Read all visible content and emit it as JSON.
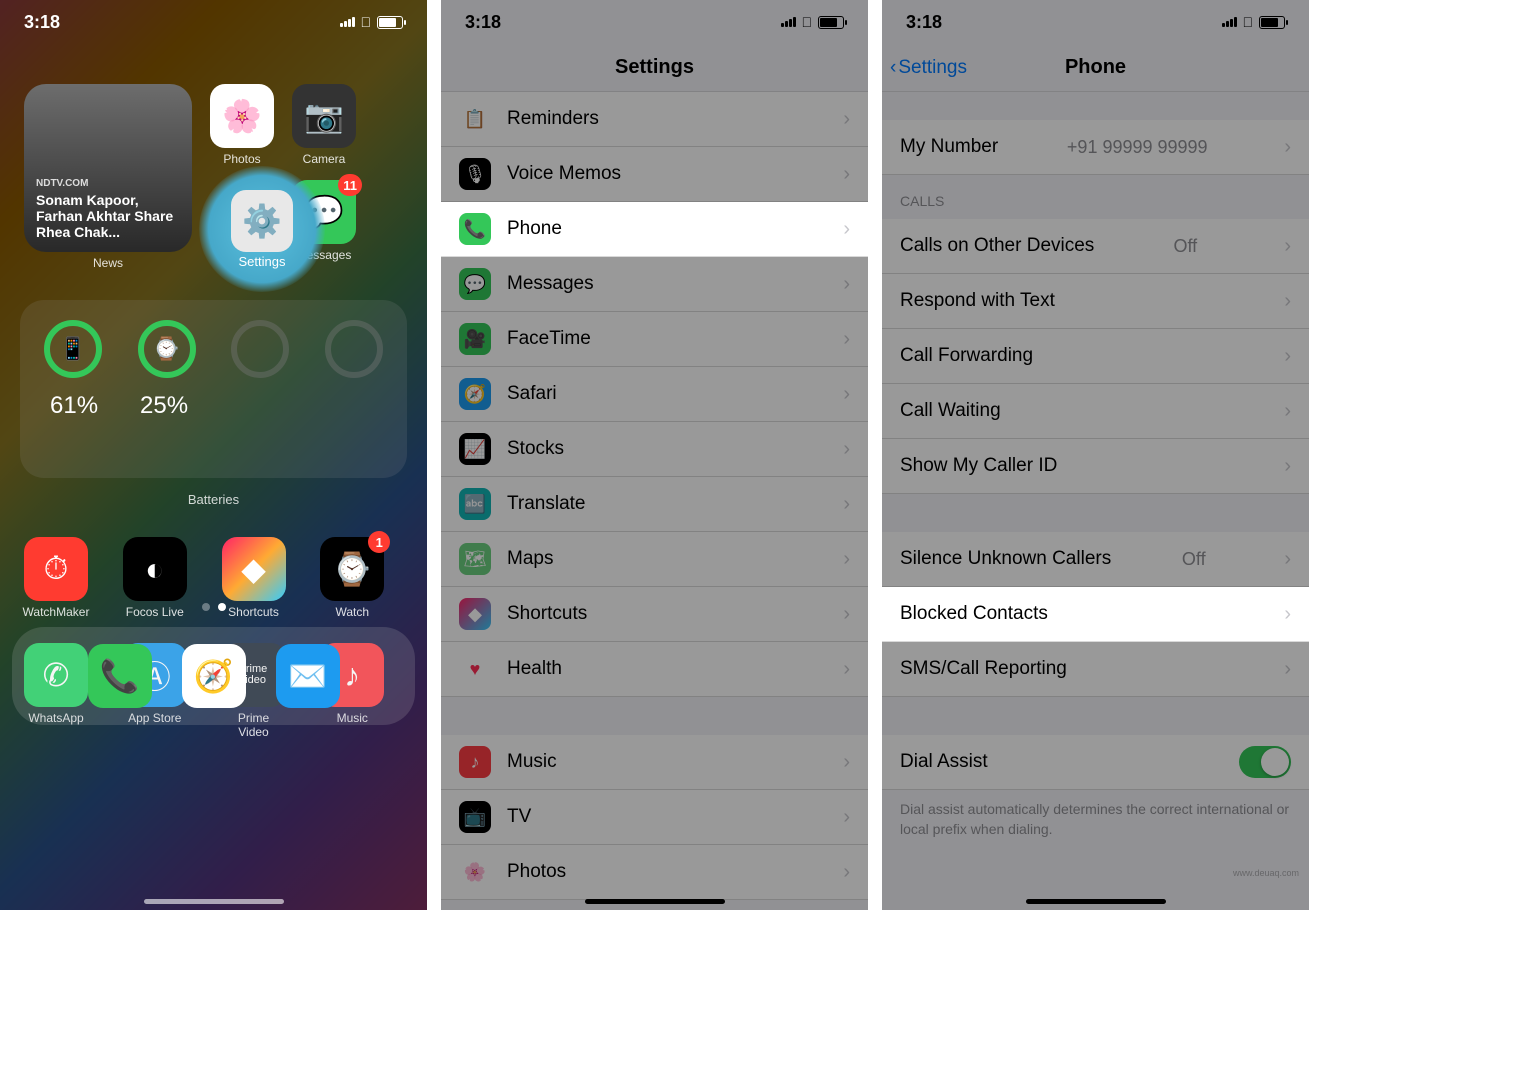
{
  "status": {
    "time": "3:18"
  },
  "p1": {
    "news": {
      "source": "NDTV.COM",
      "headline": "Sonam Kapoor, Farhan Akhtar Share Rhea Chak...",
      "label": "News"
    },
    "apps_row1": [
      {
        "name": "Photos",
        "label": "Photos",
        "bg": "#fff"
      },
      {
        "name": "Camera",
        "label": "Camera",
        "bg": "#333"
      }
    ],
    "highlight": {
      "name": "Settings",
      "label": "Settings"
    },
    "messages": {
      "label": "Messages",
      "badge": "11"
    },
    "batteries": {
      "label": "Batteries",
      "p1": "61%",
      "p2": "25%"
    },
    "grid": [
      {
        "label": "WatchMaker",
        "bg": "#ff3b30",
        "badge": ""
      },
      {
        "label": "Focos Live",
        "bg": "#000",
        "badge": ""
      },
      {
        "label": "Shortcuts",
        "bg": "#3a3a3c",
        "badge": ""
      },
      {
        "label": "Watch",
        "bg": "#000",
        "badge": "1"
      },
      {
        "label": "WhatsApp",
        "bg": "#25d366",
        "badge": ""
      },
      {
        "label": "App Store",
        "bg": "#1d9bf0",
        "badge": ""
      },
      {
        "label": "Prime Video",
        "bg": "#232f3e",
        "badge": ""
      },
      {
        "label": "Music",
        "bg": "#fc3c44",
        "badge": ""
      }
    ],
    "dock": [
      {
        "name": "Phone",
        "bg": "#34c759"
      },
      {
        "name": "Safari",
        "bg": "#fff"
      },
      {
        "name": "Mail",
        "bg": "#1d9bf0"
      }
    ]
  },
  "p2": {
    "title": "Settings",
    "rows": [
      {
        "label": "Reminders",
        "bg": "#fff"
      },
      {
        "label": "Voice Memos",
        "bg": "#000"
      },
      {
        "label": "Phone",
        "bg": "#34c759",
        "highlight": true
      },
      {
        "label": "Messages",
        "bg": "#34c759"
      },
      {
        "label": "FaceTime",
        "bg": "#34c759"
      },
      {
        "label": "Safari",
        "bg": "#1d9bf0"
      },
      {
        "label": "Stocks",
        "bg": "#000"
      },
      {
        "label": "Translate",
        "bg": "#11b5b5"
      },
      {
        "label": "Maps",
        "bg": "#6bcf7f"
      },
      {
        "label": "Shortcuts",
        "bg": "#3a3a3c"
      },
      {
        "label": "Health",
        "bg": "#fff"
      },
      {
        "label": "Music",
        "bg": "#fc3c44"
      },
      {
        "label": "TV",
        "bg": "#000"
      },
      {
        "label": "Photos",
        "bg": "#fff"
      }
    ]
  },
  "p3": {
    "back": "Settings",
    "title": "Phone",
    "my_number": {
      "label": "My Number",
      "value": "+91 99999 99999"
    },
    "calls_header": "CALLS",
    "calls": [
      {
        "label": "Calls on Other Devices",
        "value": "Off"
      },
      {
        "label": "Respond with Text",
        "value": ""
      },
      {
        "label": "Call Forwarding",
        "value": ""
      },
      {
        "label": "Call Waiting",
        "value": ""
      },
      {
        "label": "Show My Caller ID",
        "value": ""
      }
    ],
    "silence": {
      "label": "Silence Unknown Callers",
      "value": "Off"
    },
    "blocked": {
      "label": "Blocked Contacts",
      "highlight": true
    },
    "sms": {
      "label": "SMS/Call Reporting"
    },
    "dial": {
      "label": "Dial Assist"
    },
    "dial_footer": "Dial assist automatically determines the correct international or local prefix when dialing."
  },
  "watermark": "www.deuaq.com"
}
